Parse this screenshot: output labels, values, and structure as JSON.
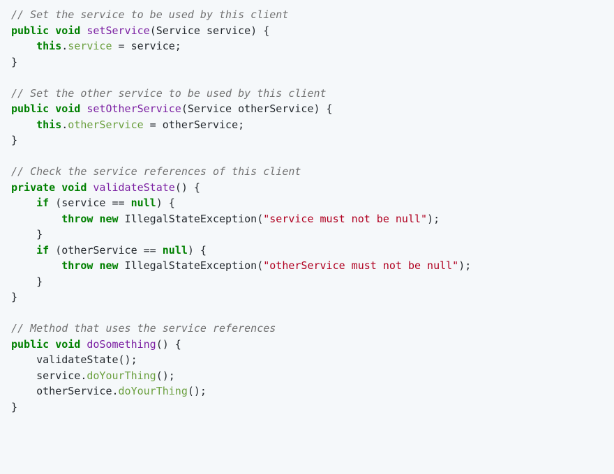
{
  "language": "java",
  "tokens": [
    [
      {
        "t": "c",
        "v": "// Set the service to be used by this client"
      }
    ],
    [
      {
        "t": "kw",
        "v": "public"
      },
      {
        "t": "op",
        "v": " "
      },
      {
        "t": "kw",
        "v": "void"
      },
      {
        "t": "op",
        "v": " "
      },
      {
        "t": "fn",
        "v": "setService"
      },
      {
        "t": "op",
        "v": "(Service service) {"
      }
    ],
    [
      {
        "t": "op",
        "v": "    "
      },
      {
        "t": "kw",
        "v": "this"
      },
      {
        "t": "op",
        "v": "."
      },
      {
        "t": "id",
        "v": "service"
      },
      {
        "t": "op",
        "v": " = service;"
      }
    ],
    [
      {
        "t": "op",
        "v": "}"
      }
    ],
    [
      {
        "t": "op",
        "v": ""
      }
    ],
    [
      {
        "t": "c",
        "v": "// Set the other service to be used by this client"
      }
    ],
    [
      {
        "t": "kw",
        "v": "public"
      },
      {
        "t": "op",
        "v": " "
      },
      {
        "t": "kw",
        "v": "void"
      },
      {
        "t": "op",
        "v": " "
      },
      {
        "t": "fn",
        "v": "setOtherService"
      },
      {
        "t": "op",
        "v": "(Service otherService) {"
      }
    ],
    [
      {
        "t": "op",
        "v": "    "
      },
      {
        "t": "kw",
        "v": "this"
      },
      {
        "t": "op",
        "v": "."
      },
      {
        "t": "id",
        "v": "otherService"
      },
      {
        "t": "op",
        "v": " = otherService;"
      }
    ],
    [
      {
        "t": "op",
        "v": "}"
      }
    ],
    [
      {
        "t": "op",
        "v": ""
      }
    ],
    [
      {
        "t": "c",
        "v": "// Check the service references of this client"
      }
    ],
    [
      {
        "t": "kw",
        "v": "private"
      },
      {
        "t": "op",
        "v": " "
      },
      {
        "t": "kw",
        "v": "void"
      },
      {
        "t": "op",
        "v": " "
      },
      {
        "t": "fn",
        "v": "validateState"
      },
      {
        "t": "op",
        "v": "() {"
      }
    ],
    [
      {
        "t": "op",
        "v": "    "
      },
      {
        "t": "kw",
        "v": "if"
      },
      {
        "t": "op",
        "v": " (service == "
      },
      {
        "t": "nl",
        "v": "null"
      },
      {
        "t": "op",
        "v": ") {"
      }
    ],
    [
      {
        "t": "op",
        "v": "        "
      },
      {
        "t": "kw",
        "v": "throw"
      },
      {
        "t": "op",
        "v": " "
      },
      {
        "t": "kw",
        "v": "new"
      },
      {
        "t": "op",
        "v": " IllegalStateException("
      },
      {
        "t": "str",
        "v": "\"service must not be null\""
      },
      {
        "t": "op",
        "v": ");"
      }
    ],
    [
      {
        "t": "op",
        "v": "    }"
      }
    ],
    [
      {
        "t": "op",
        "v": "    "
      },
      {
        "t": "kw",
        "v": "if"
      },
      {
        "t": "op",
        "v": " (otherService == "
      },
      {
        "t": "nl",
        "v": "null"
      },
      {
        "t": "op",
        "v": ") {"
      }
    ],
    [
      {
        "t": "op",
        "v": "        "
      },
      {
        "t": "kw",
        "v": "throw"
      },
      {
        "t": "op",
        "v": " "
      },
      {
        "t": "kw",
        "v": "new"
      },
      {
        "t": "op",
        "v": " IllegalStateException("
      },
      {
        "t": "str",
        "v": "\"otherService must not be null\""
      },
      {
        "t": "op",
        "v": ");"
      }
    ],
    [
      {
        "t": "op",
        "v": "    }"
      }
    ],
    [
      {
        "t": "op",
        "v": "}"
      }
    ],
    [
      {
        "t": "op",
        "v": ""
      }
    ],
    [
      {
        "t": "c",
        "v": "// Method that uses the service references"
      }
    ],
    [
      {
        "t": "kw",
        "v": "public"
      },
      {
        "t": "op",
        "v": " "
      },
      {
        "t": "kw",
        "v": "void"
      },
      {
        "t": "op",
        "v": " "
      },
      {
        "t": "fn",
        "v": "doSomething"
      },
      {
        "t": "op",
        "v": "() {"
      }
    ],
    [
      {
        "t": "op",
        "v": "    validateState();"
      }
    ],
    [
      {
        "t": "op",
        "v": "    service."
      },
      {
        "t": "id",
        "v": "doYourThing"
      },
      {
        "t": "op",
        "v": "();"
      }
    ],
    [
      {
        "t": "op",
        "v": "    otherService."
      },
      {
        "t": "id",
        "v": "doYourThing"
      },
      {
        "t": "op",
        "v": "();"
      }
    ],
    [
      {
        "t": "op",
        "v": "}"
      }
    ]
  ]
}
